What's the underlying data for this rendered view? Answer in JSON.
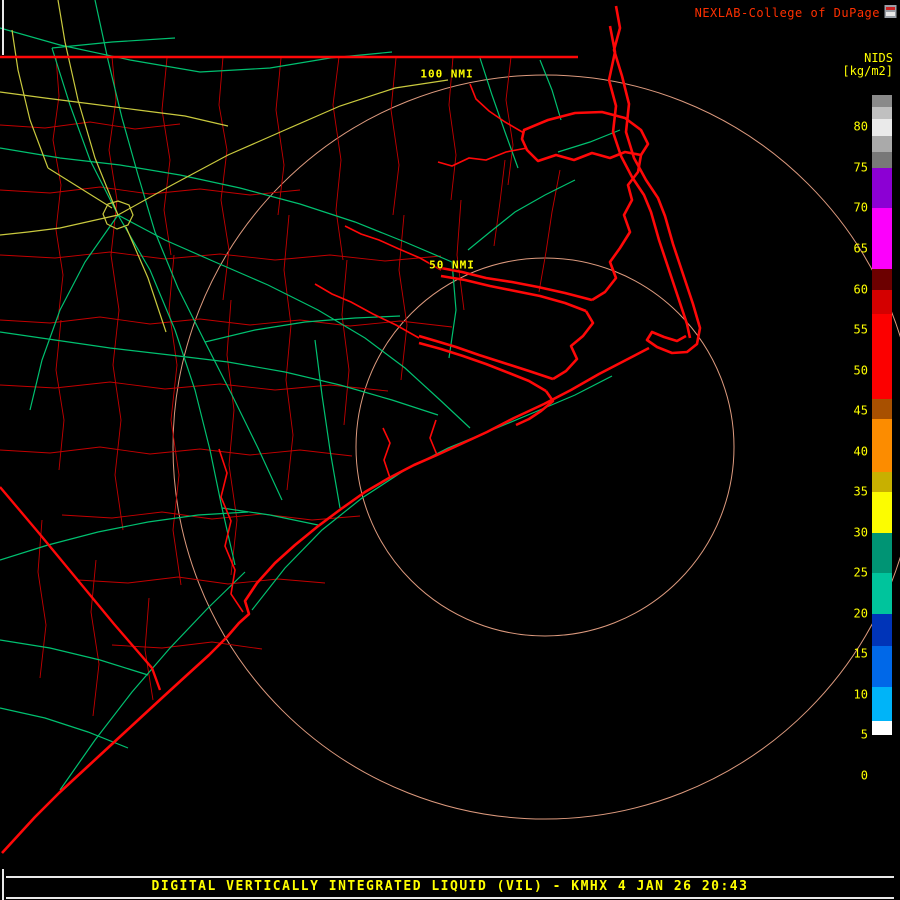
{
  "header": {
    "brand": "NEXLAB-College of DuPage",
    "brand_color": "#ff3000"
  },
  "colorbar": {
    "title": "NIDS",
    "units": "[kg/m2]",
    "tick_color": "#ffff00",
    "value_min": -2,
    "value_max": 84,
    "ticks": [
      0,
      5,
      10,
      15,
      20,
      25,
      30,
      35,
      40,
      45,
      50,
      55,
      60,
      65,
      70,
      75,
      80
    ],
    "segments": [
      {
        "from": -2,
        "to": 5,
        "color": "#000000"
      },
      {
        "from": 5,
        "to": 6.8,
        "color": "#ffffff"
      },
      {
        "from": 6.8,
        "to": 11,
        "color": "#00b4f8"
      },
      {
        "from": 11,
        "to": 16,
        "color": "#0068e8"
      },
      {
        "from": 16,
        "to": 20,
        "color": "#0034b8"
      },
      {
        "from": 20,
        "to": 25,
        "color": "#00c49c"
      },
      {
        "from": 25,
        "to": 30,
        "color": "#009474"
      },
      {
        "from": 30,
        "to": 35,
        "color": "#fcfc00"
      },
      {
        "from": 35,
        "to": 37.5,
        "color": "#c8b000"
      },
      {
        "from": 37.5,
        "to": 44,
        "color": "#fc8c00"
      },
      {
        "from": 44,
        "to": 46.5,
        "color": "#a85000"
      },
      {
        "from": 46.5,
        "to": 57,
        "color": "#fc0000"
      },
      {
        "from": 57,
        "to": 60,
        "color": "#d40000"
      },
      {
        "from": 60,
        "to": 62.5,
        "color": "#6c0000"
      },
      {
        "from": 62.5,
        "to": 70,
        "color": "#fc00fc"
      },
      {
        "from": 70,
        "to": 75,
        "color": "#8c00d4"
      },
      {
        "from": 75,
        "to": 77,
        "color": "#787878"
      },
      {
        "from": 77,
        "to": 79,
        "color": "#aaaaaa"
      },
      {
        "from": 79,
        "to": 81,
        "color": "#eaeaea"
      },
      {
        "from": 81,
        "to": 82.5,
        "color": "#c0c0c0"
      },
      {
        "from": 82.5,
        "to": 84,
        "color": "#8a8a8a"
      }
    ]
  },
  "map": {
    "range_labels": [
      {
        "text": "100 NMI"
      },
      {
        "text": "50 NMI"
      }
    ],
    "colors": {
      "coastline": "#ff0808",
      "county_border": "#c40000",
      "road_secondary": "#00c070",
      "road_highway": "#c9c93e",
      "range_ring": "#dd9a7e"
    }
  },
  "footer": {
    "title": "DIGITAL VERTICALLY INTEGRATED LIQUID (VIL) - KMHX 4 JAN 26 20:43",
    "text_color": "#ffff00"
  }
}
